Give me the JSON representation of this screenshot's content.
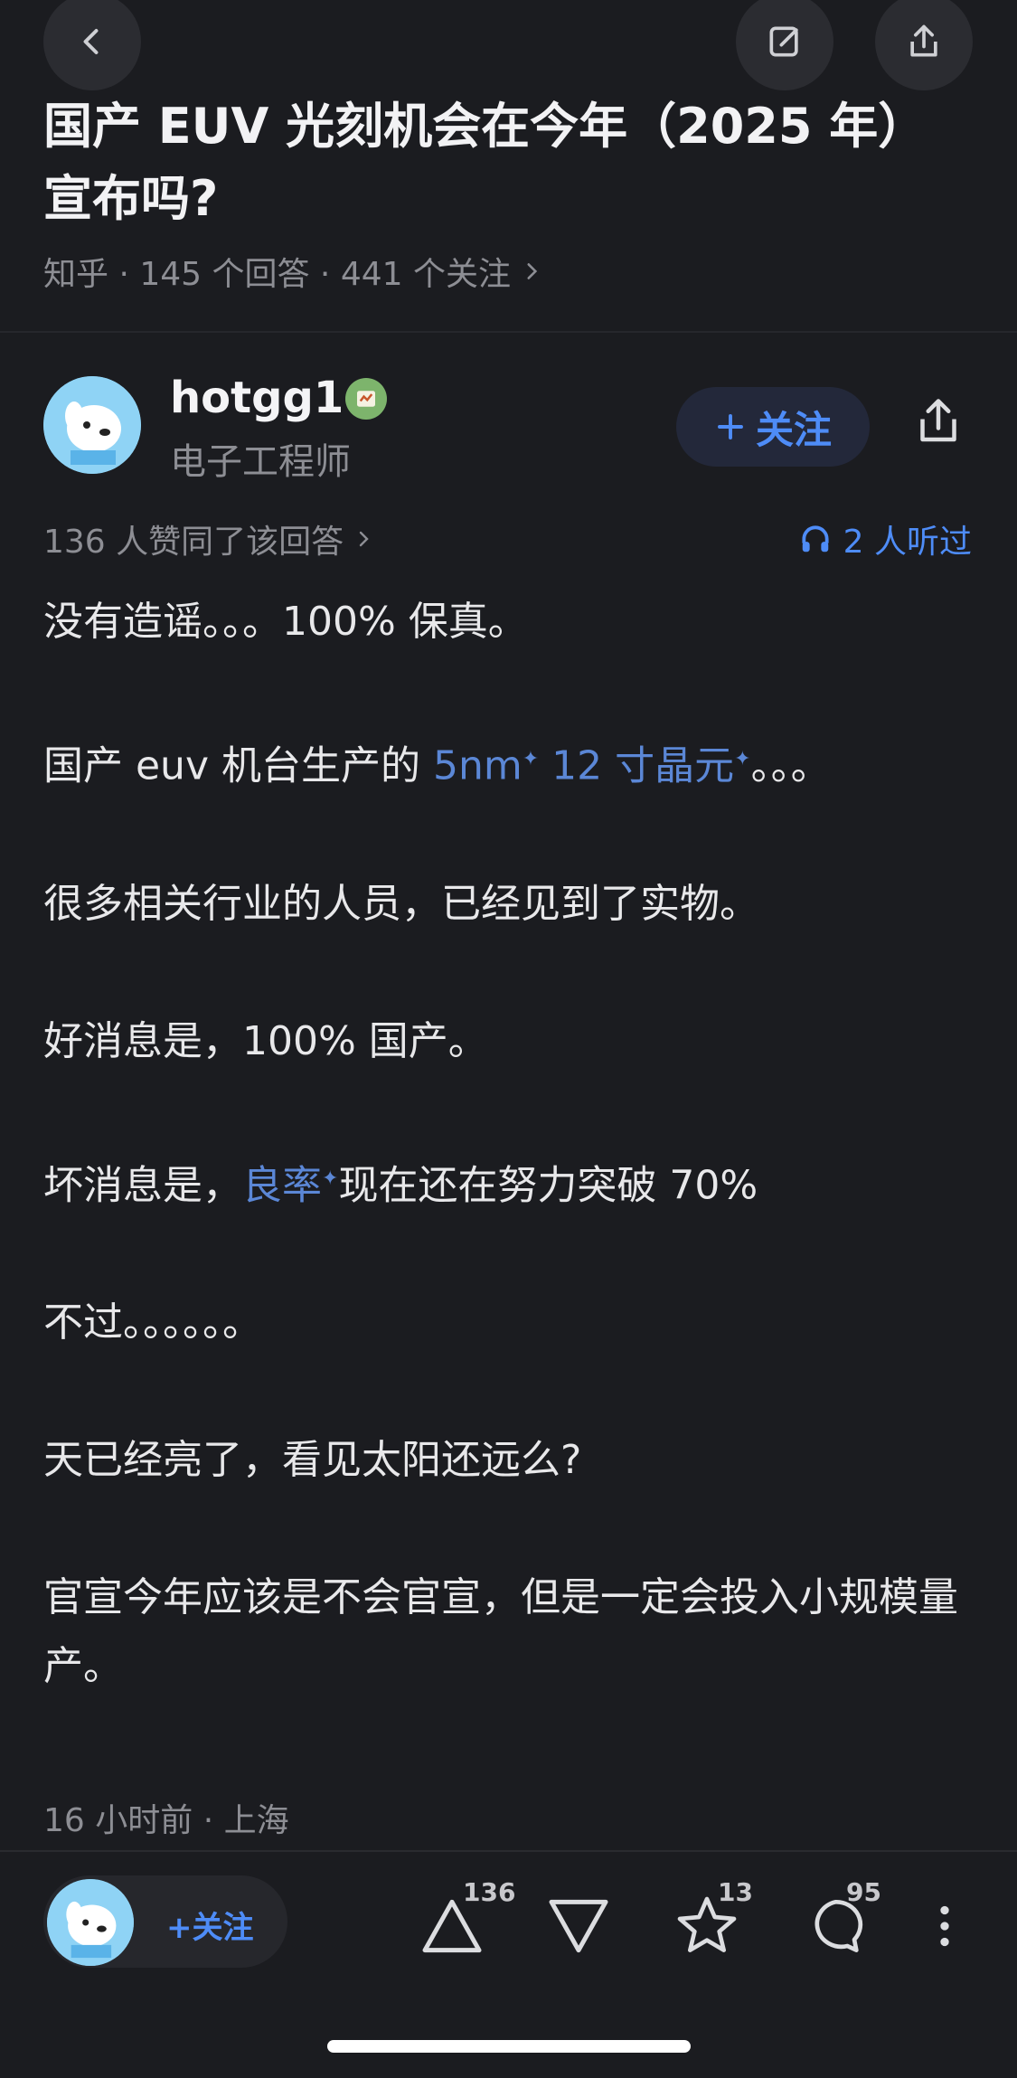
{
  "header": {
    "question_title": "国产 EUV 光刻机会在今年（2025 年）宣布吗?",
    "meta": "知乎 · 145 个回答 · 441 个关注",
    "back_icon": "chevron-left-icon",
    "edit_icon": "edit-icon",
    "share_icon": "share-icon"
  },
  "author": {
    "name": "hotgg1",
    "title": "电子工程师",
    "follow_label": "关注",
    "likes_text": "136 人赞同了该回答",
    "listened_text": "2 人听过"
  },
  "answer": {
    "p1": "没有造谣。。。100% 保真。",
    "p2_prefix": "国产 euv 机台生产的 ",
    "p2_link1": "5nm",
    "p2_link2": "12 寸晶元",
    "p2_suffix": "。。。",
    "p3": "很多相关行业的人员，已经见到了实物。",
    "p4": "好消息是，100% 国产。",
    "p5_prefix": "坏消息是，",
    "p5_link": "良率",
    "p5_suffix": "现在还在努力突破 70%",
    "p6": "不过。。。。。。",
    "p7": "天已经亮了，看见太阳还远么?",
    "p8": "官宣今年应该是不会官宣，但是一定会投入小规模量产。",
    "time_location": "16 小时前 · 上海"
  },
  "bottom_bar": {
    "follow_label": "+关注",
    "upvote_count": "136",
    "favorite_count": "13",
    "comment_count": "95"
  },
  "colors": {
    "accent": "#4e8cf7",
    "background": "#1b1c20",
    "link": "#5b87d6"
  }
}
